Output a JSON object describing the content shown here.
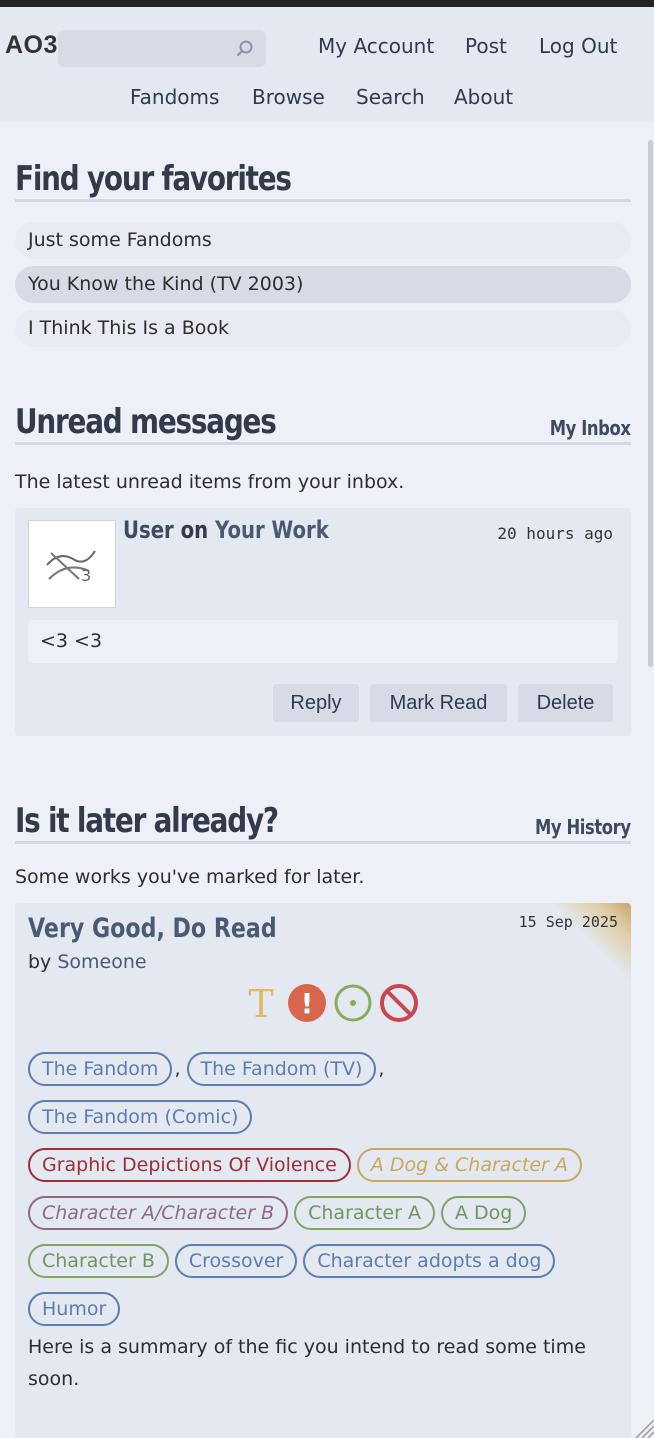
{
  "header": {
    "logo": "AO3",
    "search_placeholder": "",
    "nav_top": [
      "My Account",
      "Post",
      "Log Out"
    ],
    "nav_bottom": [
      "Fandoms",
      "Browse",
      "Search",
      "About"
    ]
  },
  "favorites": {
    "title": "Find your favorites",
    "items": [
      "Just some Fandoms",
      "You Know the Kind (TV 2003)",
      "I Think This Is a Book"
    ]
  },
  "messages": {
    "title": "Unread messages",
    "link": "My Inbox",
    "intro": "The latest unread items from your inbox.",
    "item": {
      "user": "User",
      "on": "on",
      "work": "Your Work",
      "time": "20 hours ago",
      "body": "<3 <3",
      "buttons": [
        "Reply",
        "Mark Read",
        "Delete"
      ]
    }
  },
  "later": {
    "title": "Is it later already?",
    "link": "My History",
    "intro": "Some works you've marked for later.",
    "work": {
      "title": "Very Good, Do Read",
      "date": "15 Sep 2025",
      "by_label": "by",
      "author": "Someone",
      "rating_symbol": "T",
      "warning_symbol": "!",
      "fandoms": [
        "The Fandom",
        "The Fandom (TV)",
        "The Fandom (Comic)"
      ],
      "warning_tag": "Graphic Depictions Of Violence",
      "relationships": [
        "A Dog & Character A",
        "Character A/Character B"
      ],
      "characters": [
        "Character A",
        "A Dog",
        "Character B"
      ],
      "freeforms": [
        "Crossover",
        "Character adopts a dog",
        "Humor"
      ],
      "summary": "Here is a summary of the fic you intend to read some time soon."
    }
  },
  "colors": {
    "rating_teen": "#e3b95e",
    "warning": "#d9654a",
    "category": "#86ad5a",
    "no_complete": "#c8474f"
  }
}
